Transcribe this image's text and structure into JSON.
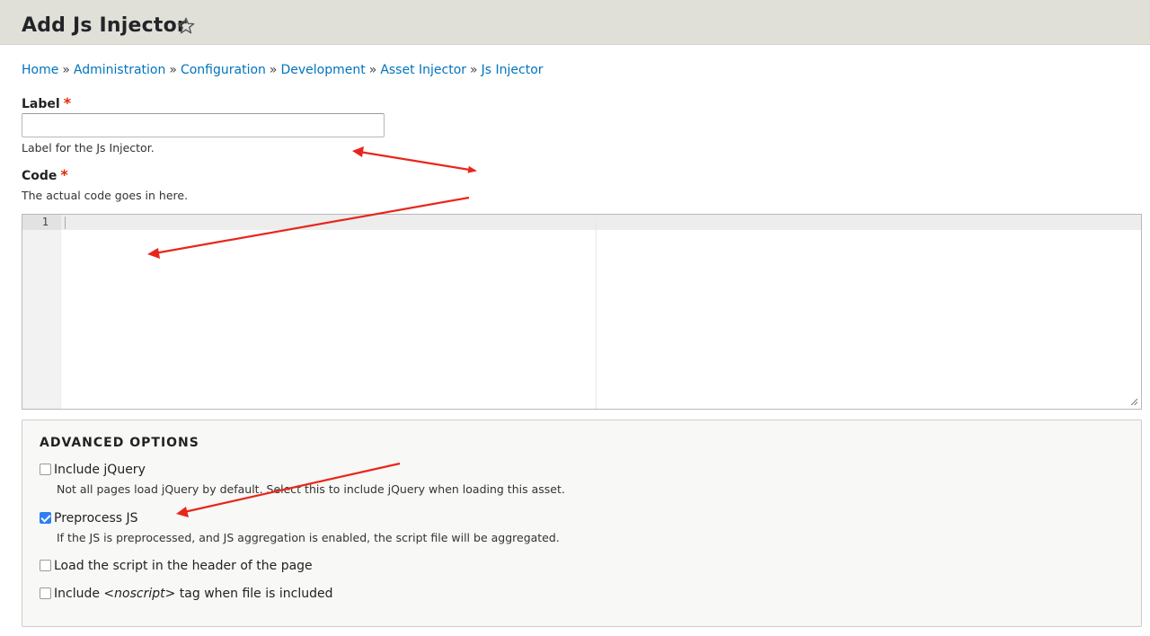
{
  "page": {
    "title": "Add Js Injector"
  },
  "breadcrumb": {
    "separator": "»",
    "items": [
      "Home",
      "Administration",
      "Configuration",
      "Development",
      "Asset Injector",
      "Js Injector"
    ]
  },
  "label_field": {
    "label": "Label",
    "required_marker": "*",
    "value": "",
    "description": "Label for the Js Injector."
  },
  "code_field": {
    "label": "Code",
    "required_marker": "*",
    "description": "The actual code goes in here.",
    "line_number": "1"
  },
  "advanced_options": {
    "legend": "ADVANCED OPTIONS",
    "include_jquery": {
      "label": "Include jQuery",
      "checked": false,
      "description": "Not all pages load jQuery by default. Select this to include jQuery when loading this asset."
    },
    "preprocess_js": {
      "label": "Preprocess JS",
      "checked": true,
      "description": "If the JS is preprocessed, and JS aggregation is enabled, the script file will be aggregated."
    },
    "header_script": {
      "label": "Load the script in the header of the page",
      "checked": false
    },
    "noscript": {
      "label_before": "Include ",
      "label_tag": "<noscript>",
      "label_after": " tag when file is included",
      "checked": false
    }
  },
  "colors": {
    "header_bg": "#e0e0d8",
    "link": "#0074bd",
    "required": "#e62600",
    "annotation_arrow": "#e8261c",
    "checkbox_checked": "#2d7ff2"
  },
  "icons": {
    "favorite": "star-outline-icon",
    "resize": "resize-grip-icon"
  }
}
